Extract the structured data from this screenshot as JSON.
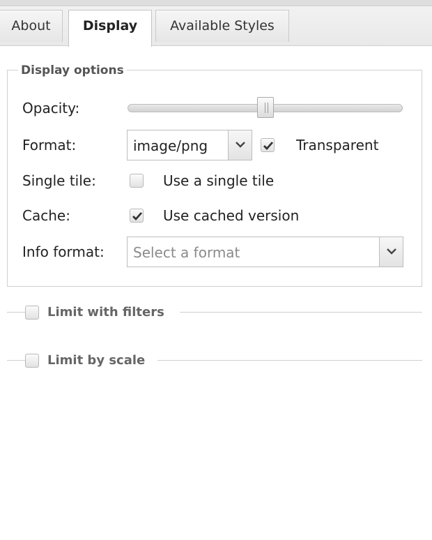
{
  "tabs": {
    "about": "About",
    "display": "Display",
    "styles": "Available Styles",
    "active": "Display"
  },
  "display_options": {
    "legend": "Display options",
    "opacity": {
      "label": "Opacity:",
      "value_fraction": 0.5
    },
    "format": {
      "label": "Format:",
      "value": "image/png",
      "transparent_checked": true,
      "transparent_label": "Transparent"
    },
    "single_tile": {
      "label": "Single tile:",
      "checked": false,
      "option_label": "Use a single tile"
    },
    "cache": {
      "label": "Cache:",
      "checked": true,
      "option_label": "Use cached version"
    },
    "info_format": {
      "label": "Info format:",
      "placeholder": "Select a format"
    }
  },
  "collapsed_sections": {
    "filters": {
      "title": "Limit with filters",
      "checked": false
    },
    "scale": {
      "title": "Limit by scale",
      "checked": false
    }
  },
  "colors": {
    "border": "#cfcfcf",
    "legend_text": "#555555",
    "placeholder_text": "#8a8a8a"
  },
  "icons": [
    "chevron-down-icon",
    "checkmark-icon",
    "slider-grip-icon"
  ]
}
